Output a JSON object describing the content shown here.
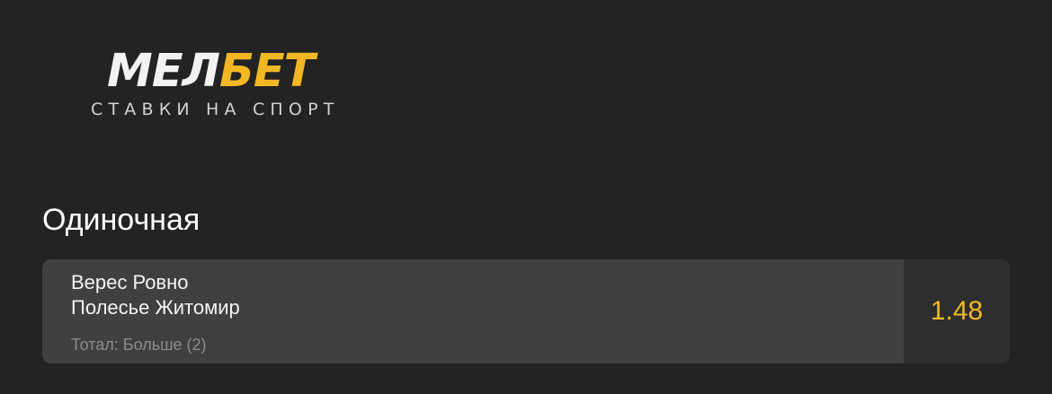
{
  "logo": {
    "word_part_a": "МЕЛ",
    "word_part_b": "БЕТ",
    "tagline": "СТАВКИ НА СПОРТ"
  },
  "bet_type": "Одиночная",
  "bet": {
    "team_home": "Верес Ровно",
    "team_away": "Полесье Житомир",
    "market": "Тотал: Больше (2)",
    "odds": "1.48"
  },
  "colors": {
    "background": "#232323",
    "card": "#404040",
    "odds_panel": "#2e2e2e",
    "accent": "#f2b824"
  }
}
